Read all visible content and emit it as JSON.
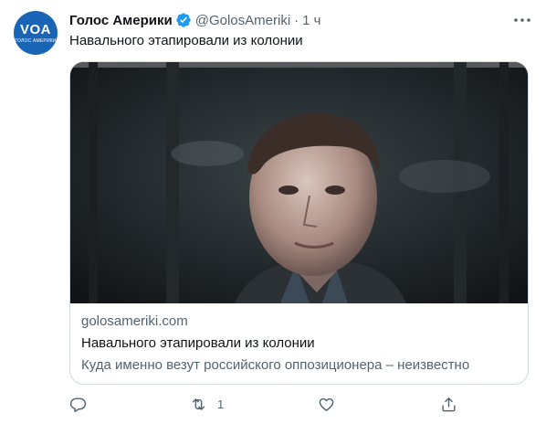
{
  "account": {
    "avatar_logo": "VOA",
    "avatar_sub": "ГОЛОС АМЕРИКИ",
    "name": "Голос Америки",
    "handle": "@GolosAmeriki",
    "separator": "·",
    "time": "1 ч"
  },
  "tweet": {
    "text": "Навального этапировали из колонии"
  },
  "card": {
    "domain": "golosameriki.com",
    "title": "Навального этапировали из колонии",
    "description": "Куда именно везут российского оппозиционера – неизвестно"
  },
  "actions": {
    "reply_count": "",
    "retweet_count": "1",
    "like_count": ""
  },
  "icons": {
    "verified": "verified-badge-icon",
    "more": "more-options-icon",
    "reply": "reply-icon",
    "retweet": "retweet-icon",
    "like": "heart-icon",
    "share": "share-icon"
  },
  "colors": {
    "brand_blue": "#1d9bf0",
    "avatar_blue": "#1a64b6",
    "text_primary": "#0f1419",
    "text_secondary": "#536471",
    "border": "#cfd9de"
  }
}
